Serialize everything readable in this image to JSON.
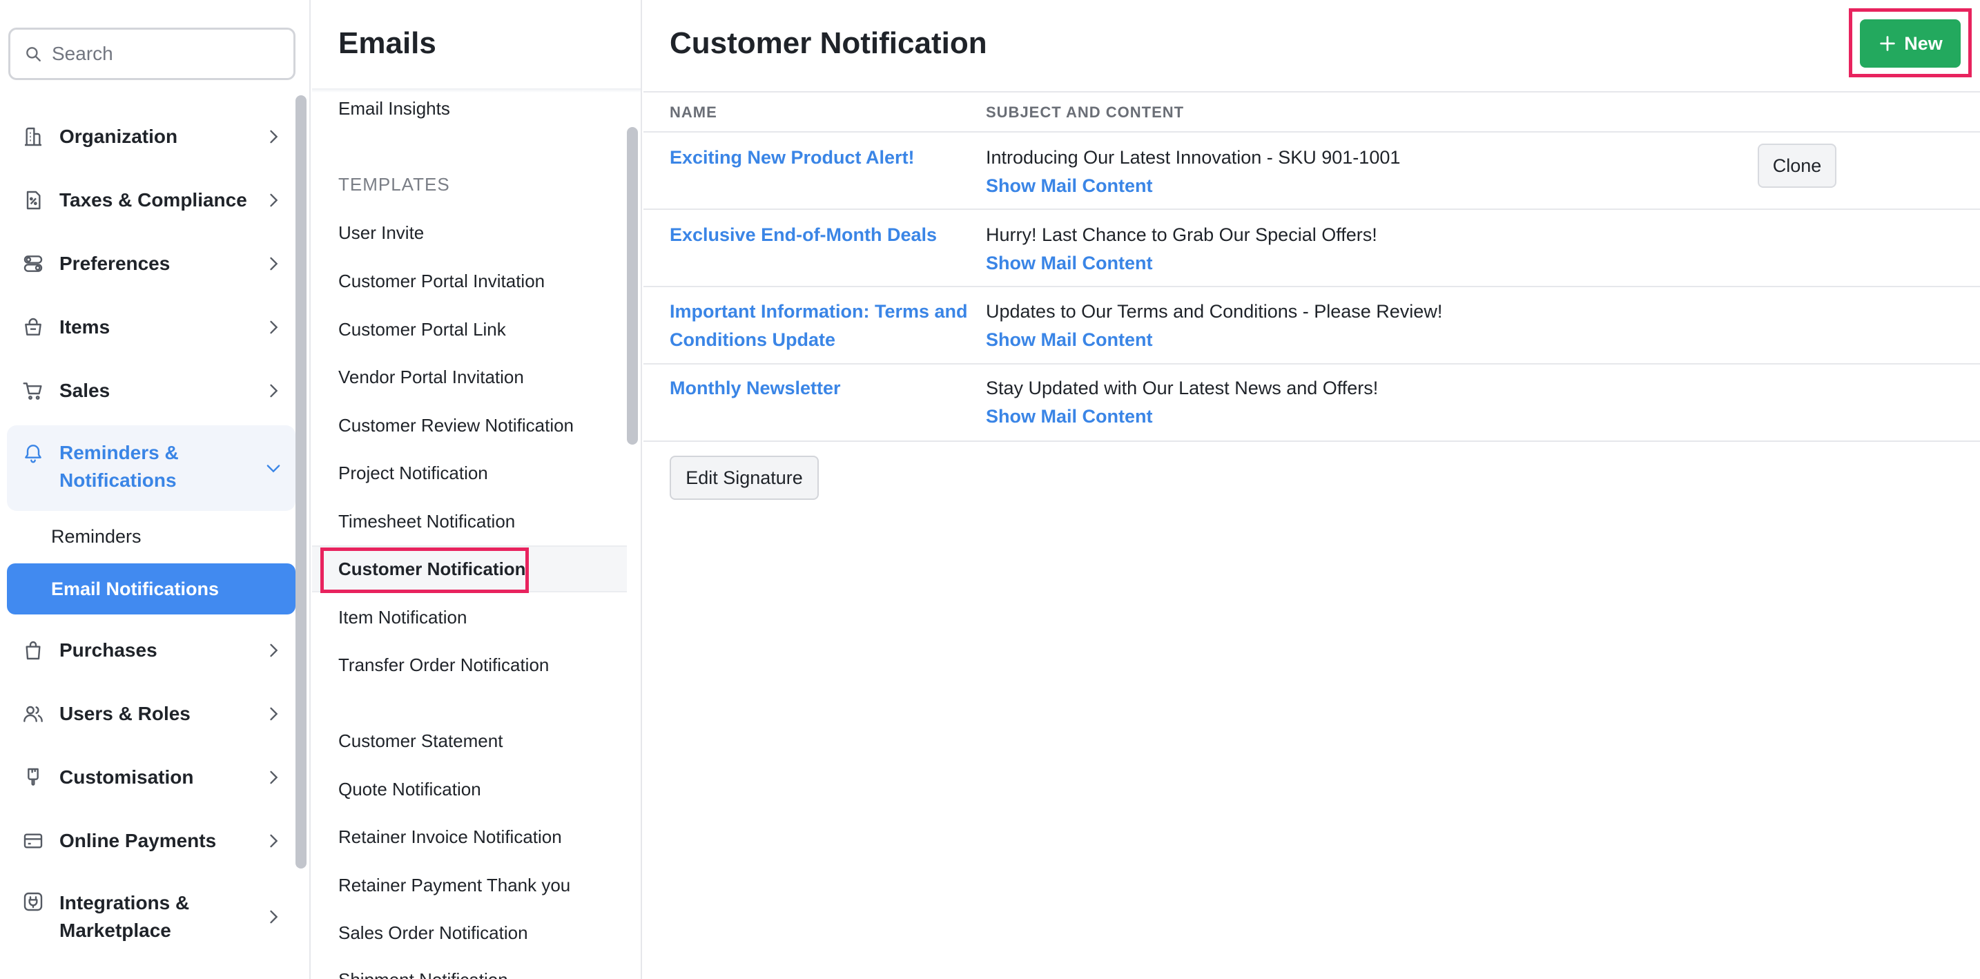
{
  "sidebar": {
    "search_placeholder": "Search",
    "items": [
      {
        "label": "Organization",
        "icon": "building-icon"
      },
      {
        "label": "Taxes & Compliance",
        "icon": "tax-document-icon"
      },
      {
        "label": "Preferences",
        "icon": "toggles-icon"
      },
      {
        "label": "Items",
        "icon": "basket-icon"
      },
      {
        "label": "Sales",
        "icon": "cart-icon"
      },
      {
        "label": "Reminders & Notifications",
        "icon": "bell-icon",
        "expanded": true
      },
      {
        "label": "Purchases",
        "icon": "shopping-bag-icon"
      },
      {
        "label": "Users & Roles",
        "icon": "users-icon"
      },
      {
        "label": "Customisation",
        "icon": "brush-icon"
      },
      {
        "label": "Online Payments",
        "icon": "credit-card-icon"
      },
      {
        "label": "Integrations & Marketplace",
        "icon": "plug-icon"
      }
    ],
    "sub_items": [
      {
        "label": "Reminders"
      },
      {
        "label": "Email Notifications",
        "active": true
      }
    ]
  },
  "emails_panel": {
    "title": "Emails",
    "top_item": "Email Insights",
    "templates_heading": "TEMPLATES",
    "templates": [
      "User Invite",
      "Customer Portal Invitation",
      "Customer Portal Link",
      "Vendor Portal Invitation",
      "Customer Review Notification",
      "Project Notification",
      "Timesheet Notification",
      "Customer Notification",
      "Item Notification",
      "Transfer Order Notification"
    ],
    "templates_2": [
      "Customer Statement",
      "Quote Notification",
      "Retainer Invoice Notification",
      "Retainer Payment Thank you",
      "Sales Order Notification",
      "Shipment Notification"
    ],
    "active_template": "Customer Notification"
  },
  "main": {
    "title": "Customer Notification",
    "new_button": "New",
    "columns": {
      "name": "NAME",
      "subject": "SUBJECT AND CONTENT"
    },
    "rows": [
      {
        "name": "Exciting New Product Alert!",
        "subject": "Introducing Our Latest Innovation - SKU 901-1001",
        "link": "Show Mail Content"
      },
      {
        "name": "Exclusive End-of-Month Deals",
        "subject": "Hurry! Last Chance to Grab Our Special Offers!",
        "link": "Show Mail Content"
      },
      {
        "name": "Important Information: Terms and Conditions Update",
        "subject": "Updates to Our Terms and Conditions - Please Review!",
        "link": "Show Mail Content"
      },
      {
        "name": "Monthly Newsletter",
        "subject": "Stay Updated with Our Latest News and Offers!",
        "link": "Show Mail Content"
      }
    ],
    "clone_button": "Clone",
    "edit_signature_button": "Edit Signature"
  },
  "colors": {
    "accent_blue": "#418af0",
    "link_blue": "#3a85e6",
    "new_green": "#23a95e",
    "highlight_red": "#e8235e"
  }
}
